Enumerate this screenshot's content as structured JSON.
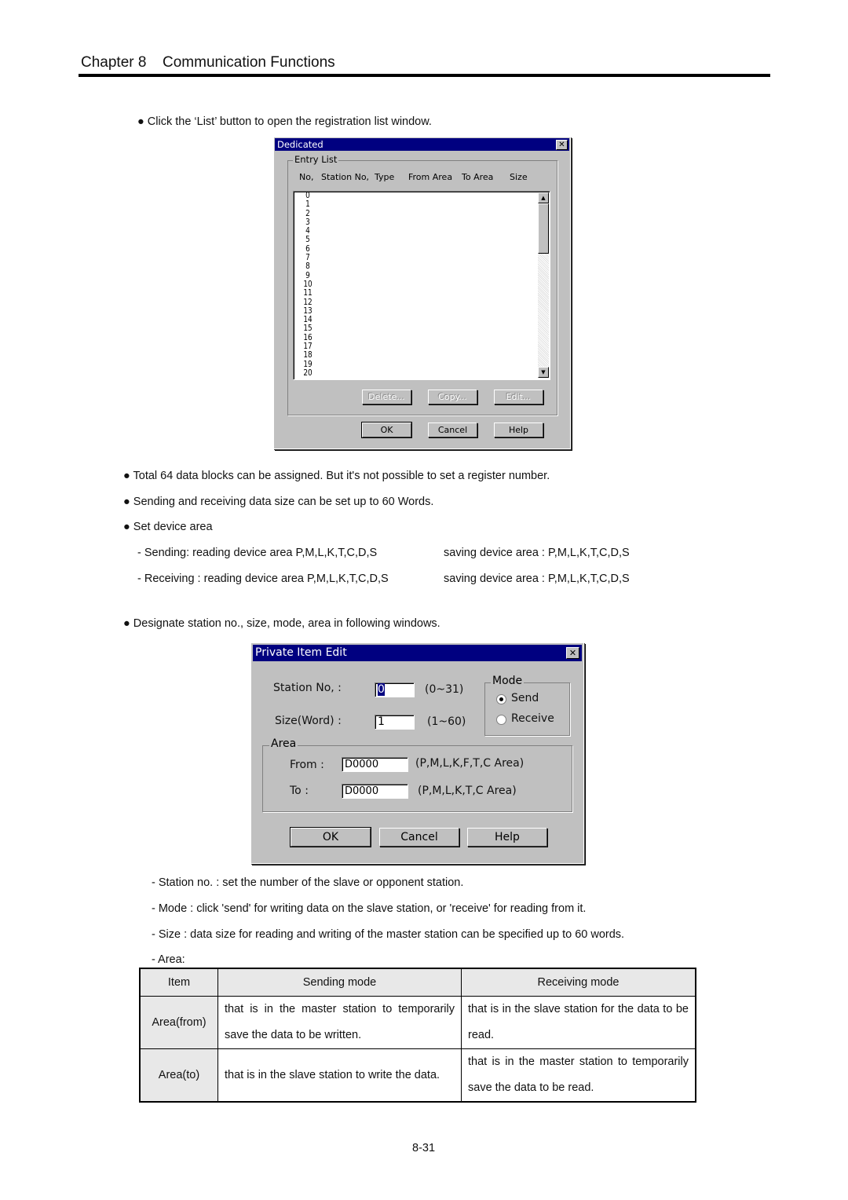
{
  "header": {
    "chapter": "Chapter 8",
    "title": "Communication Functions"
  },
  "intro": "● Click the ‘List’ button to open the registration list window.",
  "dialog1": {
    "title": "Dedicated",
    "group": "Entry List",
    "columns": [
      "No,",
      "Station No,",
      "Type",
      "From Area",
      "To Area",
      "Size"
    ],
    "rows": [
      "0",
      "1",
      "2",
      "3",
      "4",
      "5",
      "6",
      "7",
      "8",
      "9",
      "10",
      "11",
      "12",
      "13",
      "14",
      "15",
      "16",
      "17",
      "18",
      "19",
      "20"
    ],
    "buttons": {
      "delete": "Delete...",
      "copy": "Copy...",
      "edit": "Edit...",
      "ok": "OK",
      "cancel": "Cancel",
      "help": "Help"
    }
  },
  "bullets": [
    "● Total 64 data blocks can be assigned. But it's not possible to set a register number.",
    "● Sending and receiving data size can be set up to 60 Words.",
    "● Set device area"
  ],
  "device": {
    "send_l": "- Sending: reading device area P,M,L,K,T,C,D,S",
    "send_r": "saving device area : P,M,L,K,T,C,D,S",
    "recv_l": "- Receiving : reading device area P,M,L,K,T,C,D,S",
    "recv_r": "saving device area : P,M,L,K,T,C,D,S"
  },
  "designate": "● Designate station no., size, mode, area in following windows.",
  "dialog2": {
    "title": "Private Item Edit",
    "station_label": "Station No, :",
    "station_value": "0",
    "station_range": "(0~31)",
    "size_label": "Size(Word) :",
    "size_value": "1",
    "size_range": "(1~60)",
    "mode_group": "Mode",
    "mode_send": "Send",
    "mode_receive": "Receive",
    "mode_selected": "Send",
    "area_group": "Area",
    "from_label": "From :",
    "from_value": "D0000",
    "from_desc": "(P,M,L,K,F,T,C Area)",
    "to_label": "To :",
    "to_value": "D0000",
    "to_desc": "(P,M,L,K,T,C Area)",
    "ok": "OK",
    "cancel": "Cancel",
    "help": "Help"
  },
  "notes": [
    "- Station no. : set the number of the slave or opponent station.",
    "- Mode : click 'send' for writing data on the slave station, or 'receive' for reading from it.",
    "- Size : data size for reading and writing of the master station can be specified up to 60 words.",
    "- Area:"
  ],
  "table": {
    "headers": [
      "Item",
      "Sending mode",
      "Receiving mode"
    ],
    "rows": [
      [
        "Area(from)",
        "that is in the master station to temporarily save the data to be written.",
        "that is in the slave station for the data to be read."
      ],
      [
        "Area(to)",
        "that is in the slave station to write the data.",
        "that is in the master station to temporarily save the data to be read."
      ]
    ]
  },
  "page_number": "8-31",
  "colors": {
    "titlebar": "#000080",
    "dialog": "#c0c0c0"
  }
}
